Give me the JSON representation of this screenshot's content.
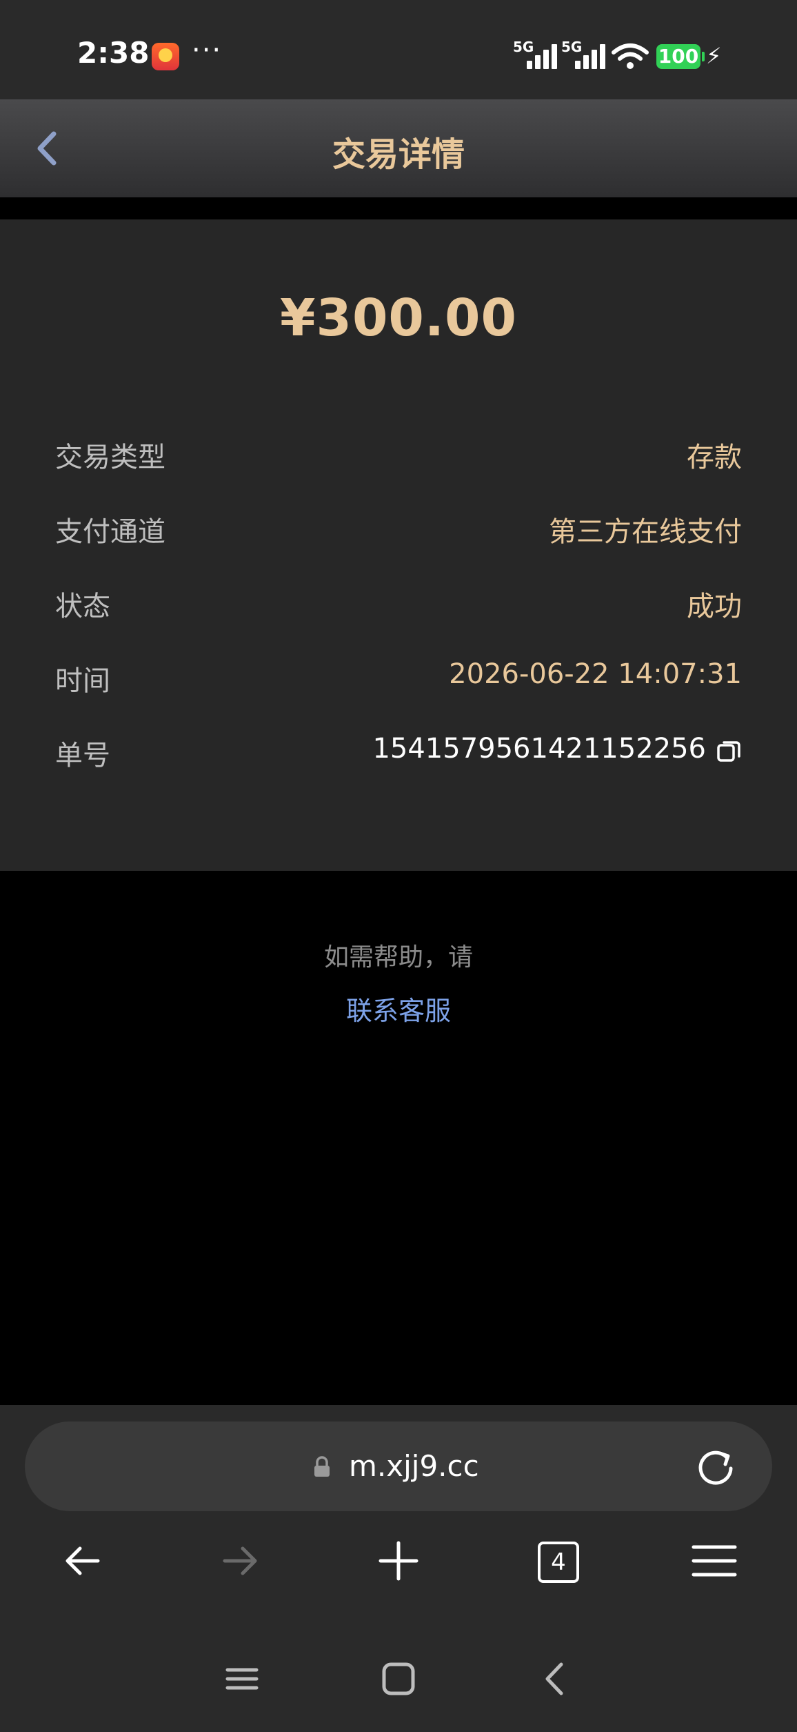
{
  "status_bar": {
    "time": "2:38",
    "dots": "···",
    "signal_1_label": "5G",
    "signal_2_label": "5G",
    "battery": "100",
    "icons": [
      "app-notification-icon",
      "signal-icon",
      "wifi-icon",
      "battery-icon",
      "charging-icon"
    ]
  },
  "header": {
    "title": "交易详情",
    "back_icon": "chevron-left-icon"
  },
  "transaction": {
    "amount": "¥300.00",
    "rows": [
      {
        "label": "交易类型",
        "value": "存款"
      },
      {
        "label": "支付通道",
        "value": "第三方在线支付"
      },
      {
        "label": "状态",
        "value": "成功"
      },
      {
        "label": "时间",
        "value": "2026-06-22 14:07:31"
      },
      {
        "label": "单号",
        "value": "1541579561421152256"
      }
    ],
    "copy_icon": "copy-icon"
  },
  "help": {
    "prompt": "如需帮助，请",
    "link": "联系客服"
  },
  "browser": {
    "url": "m.xjj9.cc",
    "tab_count": "4",
    "icons": [
      "lock-icon",
      "reload-icon",
      "back-arrow-icon",
      "forward-arrow-icon",
      "new-tab-icon",
      "tabs-icon",
      "menu-icon"
    ]
  },
  "system_nav": {
    "icons": [
      "recent-apps-icon",
      "home-icon",
      "back-icon"
    ]
  },
  "colors": {
    "accent_gold": "#e9c89b",
    "link_blue": "#7da2e8",
    "card_bg": "#272727",
    "battery_green": "#31d156"
  }
}
